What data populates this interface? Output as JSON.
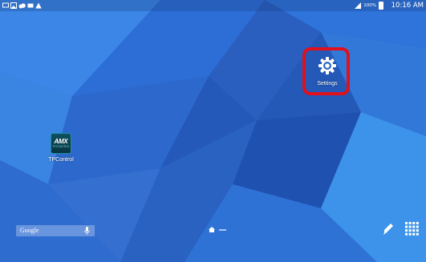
{
  "status_bar": {
    "time": "10:16 AM",
    "battery_percent": "100%",
    "left_icons": [
      "screen-mirror-icon",
      "image-icon",
      "cloud-icon",
      "email-icon",
      "warning-icon"
    ],
    "right_icons": [
      "no-sim-icon",
      "signal-icon",
      "battery-icon"
    ]
  },
  "desktop": {
    "apps": [
      {
        "label": "Settings",
        "icon": "gear-icon",
        "highlighted": true
      },
      {
        "label": "TPControl",
        "icon": "amx-icon",
        "logo_text": "AMX",
        "logo_subtext": "TPCONTROL"
      }
    ]
  },
  "bottom_bar": {
    "search_label": "Google",
    "search_icon": "mic-icon",
    "page_indicator_icon": "home-indicator-icon",
    "edit_icon": "pencil-icon",
    "apps_icon": "apps-grid-icon"
  },
  "colors": {
    "highlight": "#e0101d",
    "wallpaper": "#2a66c8",
    "amx_tile": "#0f5060"
  }
}
